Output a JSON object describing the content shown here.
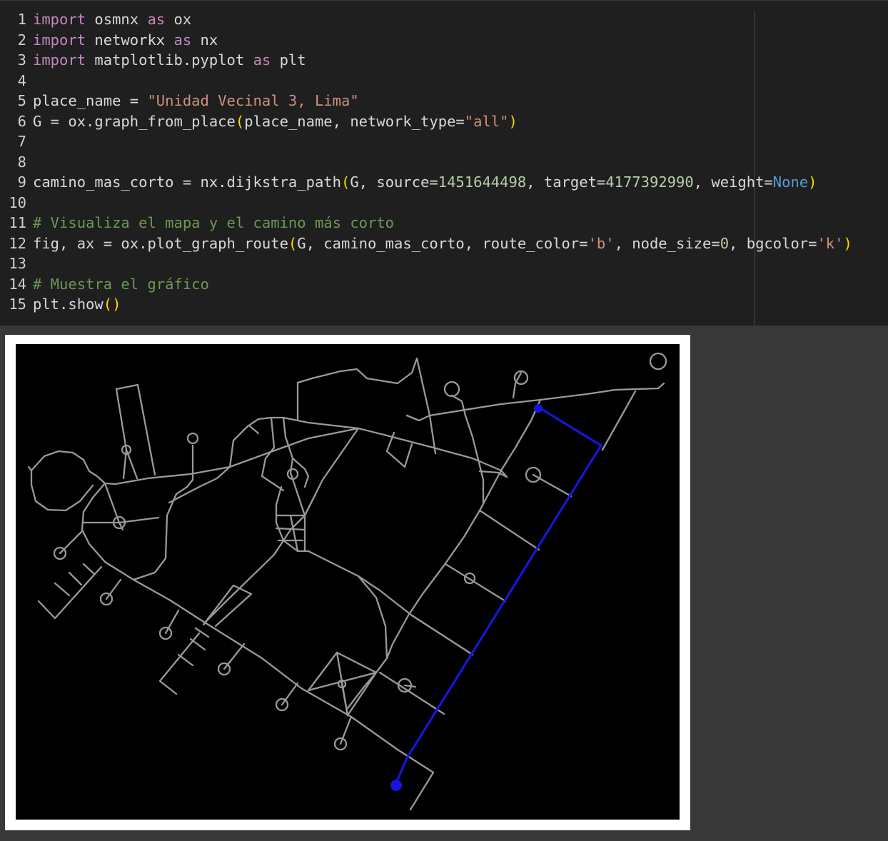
{
  "editor": {
    "lines": [
      {
        "num": "1",
        "tokens": [
          {
            "t": "import",
            "c": "#c586c0"
          },
          {
            "t": " osmnx "
          },
          {
            "t": "as",
            "c": "#c586c0"
          },
          {
            "t": " ox"
          }
        ]
      },
      {
        "num": "2",
        "tokens": [
          {
            "t": "import",
            "c": "#c586c0"
          },
          {
            "t": " networkx "
          },
          {
            "t": "as",
            "c": "#c586c0"
          },
          {
            "t": " nx"
          }
        ]
      },
      {
        "num": "3",
        "tokens": [
          {
            "t": "import",
            "c": "#c586c0"
          },
          {
            "t": " matplotlib.pyplot "
          },
          {
            "t": "as",
            "c": "#c586c0"
          },
          {
            "t": " plt"
          }
        ]
      },
      {
        "num": "4",
        "tokens": []
      },
      {
        "num": "5",
        "tokens": [
          {
            "t": "place_name = "
          },
          {
            "t": "\"Unidad Vecinal 3, Lima\"",
            "c": "#ce9178"
          }
        ]
      },
      {
        "num": "6",
        "tokens": [
          {
            "t": "G = ox.graph_from_place"
          },
          {
            "t": "(",
            "c": "#ffd700"
          },
          {
            "t": "place_name, network_type="
          },
          {
            "t": "\"all\"",
            "c": "#ce9178"
          },
          {
            "t": ")",
            "c": "#ffd700"
          }
        ]
      },
      {
        "num": "7",
        "tokens": []
      },
      {
        "num": "8",
        "tokens": []
      },
      {
        "num": "9",
        "tokens": [
          {
            "t": "camino_mas_corto = nx.dijkstra_path"
          },
          {
            "t": "(",
            "c": "#ffd700"
          },
          {
            "t": "G, source="
          },
          {
            "t": "1451644498",
            "c": "#b5cea8"
          },
          {
            "t": ", target="
          },
          {
            "t": "4177392990",
            "c": "#b5cea8"
          },
          {
            "t": ", weight="
          },
          {
            "t": "None",
            "c": "#569cd6"
          },
          {
            "t": ")",
            "c": "#ffd700"
          }
        ]
      },
      {
        "num": "10",
        "tokens": []
      },
      {
        "num": "11",
        "tokens": [
          {
            "t": "# Visualiza el mapa y el camino más corto",
            "c": "#6a9955"
          }
        ]
      },
      {
        "num": "12",
        "tokens": [
          {
            "t": "fig, ax = ox.plot_graph_route"
          },
          {
            "t": "(",
            "c": "#ffd700"
          },
          {
            "t": "G, camino_mas_corto, route_color="
          },
          {
            "t": "'b'",
            "c": "#ce9178"
          },
          {
            "t": ", node_size="
          },
          {
            "t": "0",
            "c": "#b5cea8"
          },
          {
            "t": ", bgcolor="
          },
          {
            "t": "'k'",
            "c": "#ce9178"
          },
          {
            "t": ")",
            "c": "#ffd700"
          }
        ]
      },
      {
        "num": "13",
        "tokens": []
      },
      {
        "num": "14",
        "tokens": [
          {
            "t": "# Muestra el gráfico",
            "c": "#6a9955"
          }
        ]
      },
      {
        "num": "15",
        "tokens": [
          {
            "t": "plt.show"
          },
          {
            "t": "()",
            "c": "#ffd700"
          }
        ]
      }
    ]
  },
  "plot": {
    "background_color": "#000000",
    "edge_color": "#999999",
    "route_color": "#1515dd",
    "figure_facecolor": "#ffffff"
  }
}
